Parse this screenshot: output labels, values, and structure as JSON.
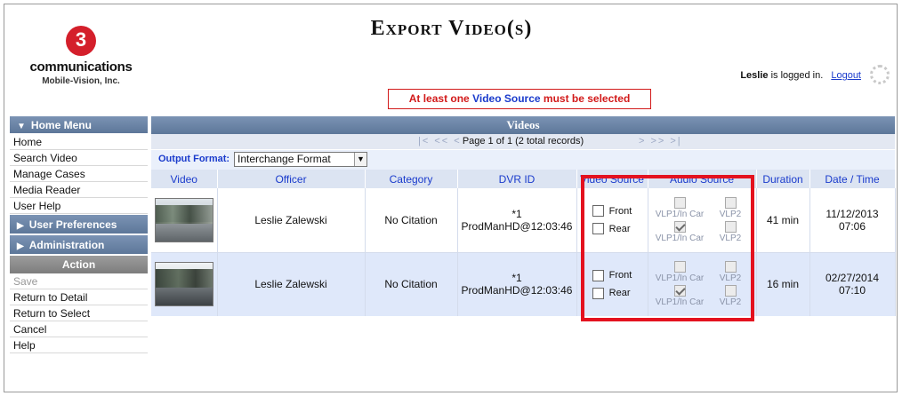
{
  "brand": {
    "logo_mark": "3",
    "company": "communications",
    "subtitle": "Mobile-Vision, Inc."
  },
  "page_title": "Export Video(s)",
  "login": {
    "user": "Leslie",
    "logged_in_text": "is logged in.",
    "logout_label": "Logout"
  },
  "alert": {
    "prefix": "At least one ",
    "highlight": "Video Source",
    "suffix": " must be selected"
  },
  "sidebar": {
    "home_menu_title": "Home Menu",
    "home_items": [
      "Home",
      "Search Video",
      "Manage Cases",
      "Media Reader",
      "User Help"
    ],
    "user_prefs_title": "User Preferences",
    "administration_title": "Administration",
    "action_title": "Action",
    "action_items": [
      "Save",
      "Return to Detail",
      "Return to Select",
      "Cancel",
      "Help"
    ]
  },
  "videos": {
    "title": "Videos",
    "pager_info": "Page 1 of 1 (2 total records)",
    "pager_prev": "|<  <<  <",
    "pager_next": ">  >>  >|",
    "output_format_label": "Output Format:",
    "output_format_value": "Interchange Format",
    "columns": [
      "Video",
      "Officer",
      "Category",
      "DVR ID",
      "Video Source",
      "Audio Source",
      "Duration",
      "Date / Time"
    ],
    "rows": [
      {
        "officer": "Leslie Zalewski",
        "category": "No Citation",
        "dvr_id": "*1 ProdManHD@12:03:46",
        "video_sources": [
          "Front",
          "Rear"
        ],
        "audio_sources": [
          {
            "label": "VLP1/In Car",
            "checked": false
          },
          {
            "label": "VLP2",
            "checked": false
          },
          {
            "label": "VLP1/In Car",
            "checked": true
          },
          {
            "label": "VLP2",
            "checked": false
          }
        ],
        "duration": "41 min",
        "date": "11/12/2013",
        "time": "07:06"
      },
      {
        "officer": "Leslie Zalewski",
        "category": "No Citation",
        "dvr_id": "*1 ProdManHD@12:03:46",
        "video_sources": [
          "Front",
          "Rear"
        ],
        "audio_sources": [
          {
            "label": "VLP1/In Car",
            "checked": false
          },
          {
            "label": "VLP2",
            "checked": false
          },
          {
            "label": "VLP1/In Car",
            "checked": true
          },
          {
            "label": "VLP2",
            "checked": false
          }
        ],
        "duration": "16 min",
        "date": "02/27/2014",
        "time": "07:10"
      }
    ]
  },
  "colors": {
    "header_blue": "#5d7799",
    "alert_red": "#d21a1a",
    "link_blue": "#1a3bcc",
    "highlight_outline": "#e4121f",
    "row_alt": "#dfe8fa"
  }
}
